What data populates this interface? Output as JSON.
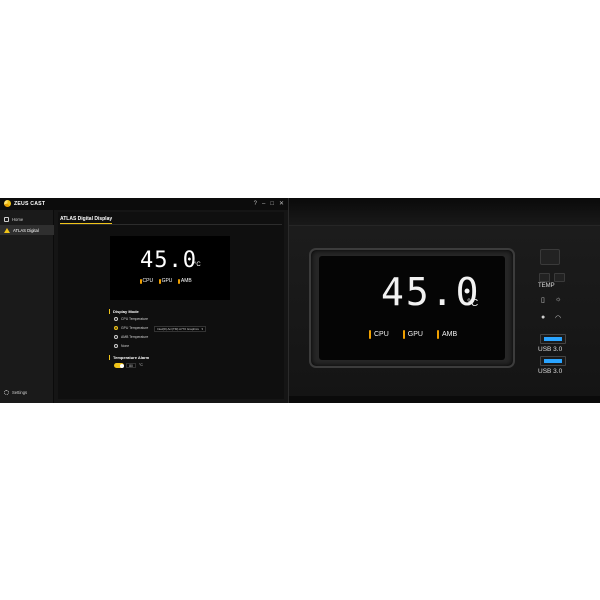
{
  "app": {
    "brand": "ZEUS CAST",
    "window_controls": [
      "?",
      "–",
      "□",
      "✕"
    ]
  },
  "sidebar": {
    "items": [
      {
        "label": "Home",
        "icon": "home-icon"
      },
      {
        "label": "ATLAS Digital",
        "icon": "atlas-icon",
        "active": true
      }
    ],
    "settings_label": "Settings"
  },
  "main": {
    "section_title": "ATLAS Digital Display",
    "preview": {
      "temperature": "45.0",
      "unit": "°C",
      "labels": [
        "CPU",
        "GPU",
        "AMB"
      ]
    },
    "display_mode": {
      "label": "Display Mode",
      "options": [
        {
          "label": "CPU Temperature",
          "selected": false
        },
        {
          "label": "GPU Temperature",
          "selected": true
        },
        {
          "label": "AMB Temperature",
          "selected": false
        },
        {
          "label": "None",
          "selected": false
        }
      ],
      "gpu_select_value": "Intel(R) Arc(TM) A770 Graphics"
    },
    "alarm": {
      "label": "Temperature Alarm",
      "enabled": true,
      "value": "80",
      "unit": "°C"
    }
  },
  "photo": {
    "temperature": "45.0",
    "unit": "°C",
    "labels": [
      "CPU",
      "GPU",
      "AMB"
    ],
    "panel_temp_label": "TEMP",
    "usb_labels": [
      "USB 3.0",
      "USB 3.0"
    ]
  },
  "colors": {
    "accent": "#f0c419",
    "thermometer": "#f0a000",
    "usb_blue": "#2aa4ff",
    "window_bg": "#151515"
  }
}
